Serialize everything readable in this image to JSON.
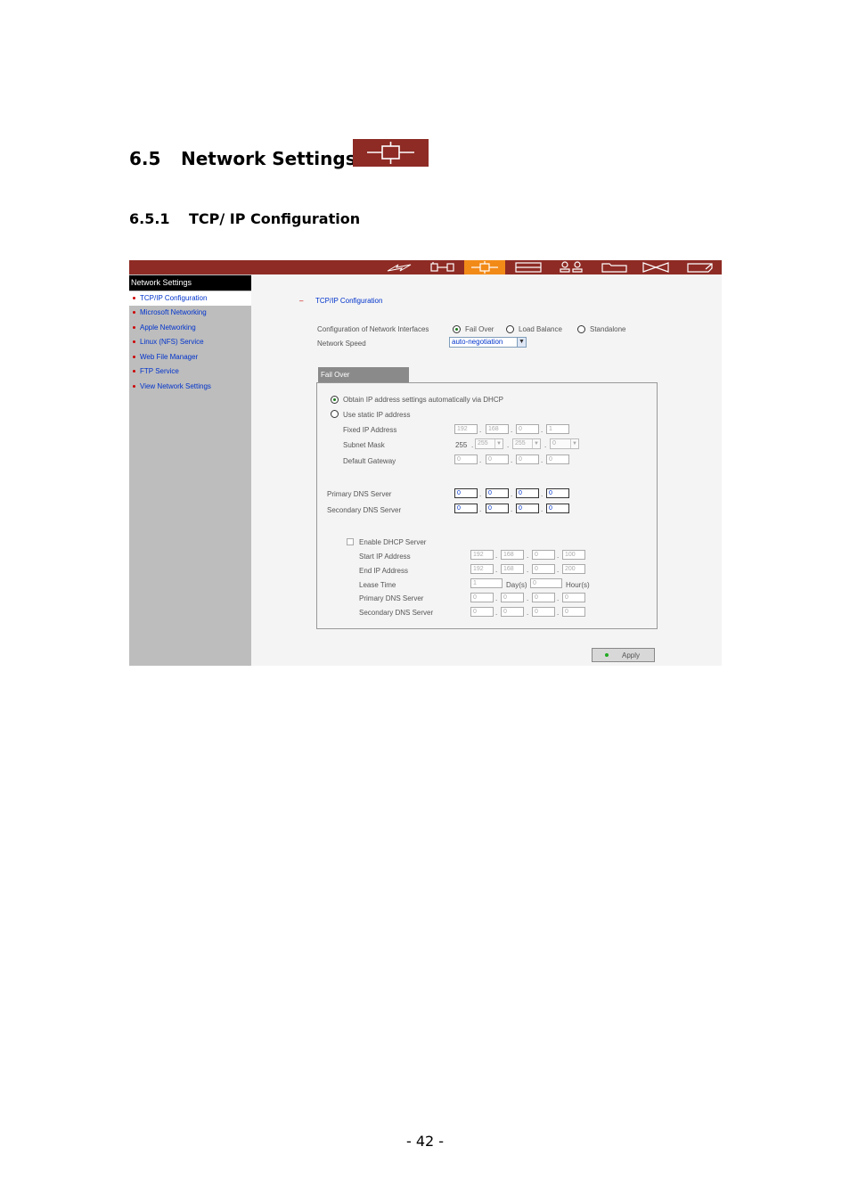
{
  "section": {
    "number": "6.5",
    "title": "Network Settings",
    "icon": "network-settings-icon"
  },
  "subsection": {
    "number": "6.5.1",
    "title": "TCP/ IP Configuration"
  },
  "toolbar_icons": [
    "quick-config-icon",
    "system-settings-icon",
    "network-settings-icon",
    "device-config-icon",
    "user-management-icon",
    "share-folder-icon",
    "system-tools-icon",
    "statistics-logs-icon"
  ],
  "sidebar": {
    "title": "Network Settings",
    "items": [
      "TCP/IP Configuration",
      "Microsoft Networking",
      "Apple Networking",
      "Linux (NFS) Service",
      "Web File Manager",
      "FTP Service",
      "View Network Settings"
    ]
  },
  "main": {
    "section_marker": "–",
    "section_title": "TCP/IP Configuration",
    "config_label": "Configuration of Network Interfaces",
    "modes": [
      "Fail Over",
      "Load Balance",
      "Standalone"
    ],
    "selected_mode": "Fail Over",
    "speed_label": "Network Speed",
    "speed_value": "auto-negotiation",
    "tab_label": "Fail Over",
    "dhcp_option": "Obtain IP address settings automatically via DHCP",
    "static_option": "Use static IP address",
    "fixed_ip_label": "Fixed IP Address",
    "fixed_ip": [
      "192",
      "168",
      "0",
      "1"
    ],
    "subnet_label": "Subnet Mask",
    "subnet": [
      "255",
      "255",
      "255",
      "0"
    ],
    "gateway_label": "Default Gateway",
    "gateway": [
      "0",
      "0",
      "0",
      "0"
    ],
    "primary_dns_label": "Primary DNS Server",
    "primary_dns": [
      "0",
      "0",
      "0",
      "0"
    ],
    "secondary_dns_label": "Secondary DNS Server",
    "secondary_dns": [
      "0",
      "0",
      "0",
      "0"
    ],
    "dhcp_server": {
      "enable_label": "Enable DHCP Server",
      "start_label": "Start IP Address",
      "start_ip": [
        "192",
        "168",
        "0",
        "100"
      ],
      "end_label": "End IP Address",
      "end_ip": [
        "192",
        "168",
        "0",
        "200"
      ],
      "lease_label": "Lease Time",
      "lease_days": "1",
      "days_unit": "Day(s)",
      "lease_hours": "0",
      "hours_unit": "Hour(s)",
      "primary_dns_label": "Primary DNS Server",
      "primary_dns": [
        "0",
        "0",
        "0",
        "0"
      ],
      "secondary_dns_label": "Secondary DNS Server",
      "secondary_dns": [
        "0",
        "0",
        "0",
        "0"
      ]
    },
    "apply_label": "Apply"
  },
  "page_number": "- 42 -"
}
